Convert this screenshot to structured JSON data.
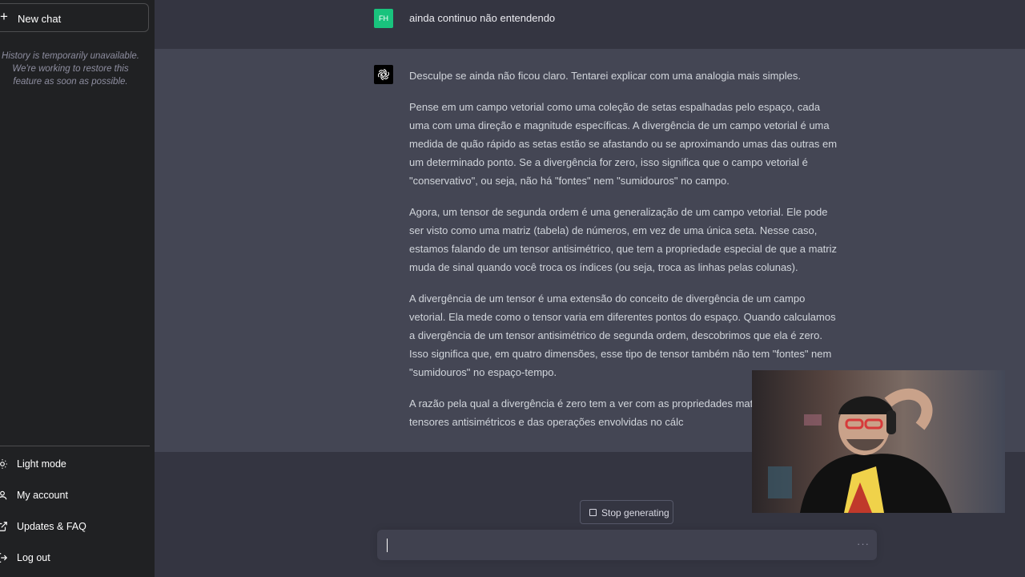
{
  "sidebar": {
    "new_chat_label": "New chat",
    "history_message": "History is temporarily unavailable. We're working to restore this feature as soon as possible.",
    "items": [
      {
        "label": "Light mode",
        "icon": "sun-icon"
      },
      {
        "label": "My account",
        "icon": "user-icon"
      },
      {
        "label": "Updates & FAQ",
        "icon": "external-link-icon"
      },
      {
        "label": "Log out",
        "icon": "logout-icon"
      }
    ]
  },
  "conversation": {
    "user_initials": "FH",
    "user_message": "ainda continuo não entendendo",
    "assistant_paragraphs": [
      "Desculpe se ainda não ficou claro. Tentarei explicar com uma analogia mais simples.",
      "Pense em um campo vetorial como uma coleção de setas espalhadas pelo espaço, cada uma com uma direção e magnitude específicas. A divergência de um campo vetorial é uma medida de quão rápido as setas estão se afastando ou se aproximando umas das outras em um determinado ponto. Se a divergência for zero, isso significa que o campo vetorial é \"conservativo\", ou seja, não há \"fontes\" nem \"sumidouros\" no campo.",
      "Agora, um tensor de segunda ordem é uma generalização de um campo vetorial. Ele pode ser visto como uma matriz (tabela) de números, em vez de uma única seta. Nesse caso, estamos falando de um tensor antisimétrico, que tem a propriedade especial de que a matriz muda de sinal quando você troca os índices (ou seja, troca as linhas pelas colunas).",
      "A divergência de um tensor é uma extensão do conceito de divergência de um campo vetorial. Ela mede como o tensor varia em diferentes pontos do espaço. Quando calculamos a divergência de um tensor antisimétrico de segunda ordem, descobrimos que ela é zero. Isso significa que, em quatro dimensões, esse tipo de tensor também não tem \"fontes\" nem \"sumidouros\" no espaço-tempo.",
      "A razão pela qual a divergência é zero tem a ver com as propriedades mate específicas dos tensores antisimétricos e das operações envolvidas no cálc"
    ]
  },
  "controls": {
    "stop_label": "Stop generating",
    "input_value": "",
    "input_menu": "···"
  },
  "colors": {
    "sidebar_bg": "#202123",
    "main_bg": "#343541",
    "assistant_bg": "#444654",
    "user_avatar": "#19c37d"
  }
}
